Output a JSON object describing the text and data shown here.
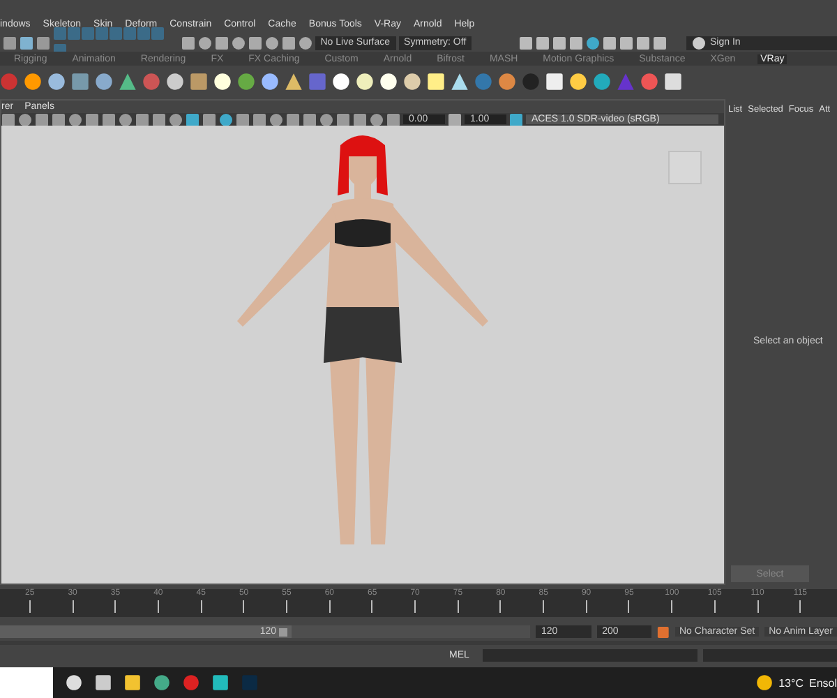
{
  "menu_bar": {
    "items": [
      "indows",
      "Skeleton",
      "Skin",
      "Deform",
      "Constrain",
      "Control",
      "Cache",
      "Bonus Tools",
      "V-Ray",
      "Arnold",
      "Help"
    ]
  },
  "status_line": {
    "live_surface": "No Live Surface",
    "symmetry": "Symmetry: Off",
    "account": "Sign In"
  },
  "shelf_tabs": [
    {
      "label": "Rigging",
      "selected": false
    },
    {
      "label": "Animation",
      "selected": false
    },
    {
      "label": "Rendering",
      "selected": false
    },
    {
      "label": "FX",
      "selected": false
    },
    {
      "label": "FX Caching",
      "selected": false
    },
    {
      "label": "Custom",
      "selected": false
    },
    {
      "label": "Arnold",
      "selected": false
    },
    {
      "label": "Bifrost",
      "selected": false
    },
    {
      "label": "MASH",
      "selected": false
    },
    {
      "label": "Motion Graphics",
      "selected": false
    },
    {
      "label": "Substance",
      "selected": false
    },
    {
      "label": "XGen",
      "selected": false
    },
    {
      "label": "VRay",
      "selected": true
    }
  ],
  "viewport": {
    "menu": [
      "rer",
      "Panels"
    ],
    "exposure": "0.00",
    "gamma": "1.00",
    "color_space": "ACES 1.0 SDR-video (sRGB)"
  },
  "side_panel": {
    "tabs": [
      "List",
      "Selected",
      "Focus",
      "Att"
    ],
    "message": "Select an object",
    "button": "Select"
  },
  "timeline": {
    "ticks": [
      "25",
      "30",
      "35",
      "40",
      "45",
      "50",
      "55",
      "60",
      "65",
      "70",
      "75",
      "80",
      "85",
      "90",
      "95",
      "100",
      "105",
      "110",
      "115"
    ]
  },
  "range": {
    "level": 0.55,
    "slider_end": "120",
    "end_field": "120",
    "max_field": "200",
    "character_set": "No Character Set",
    "anim_layer": "No Anim Layer"
  },
  "command_line": {
    "language": "MEL"
  },
  "taskbar": {
    "temperature": "13°C",
    "weather": "Ensol"
  }
}
